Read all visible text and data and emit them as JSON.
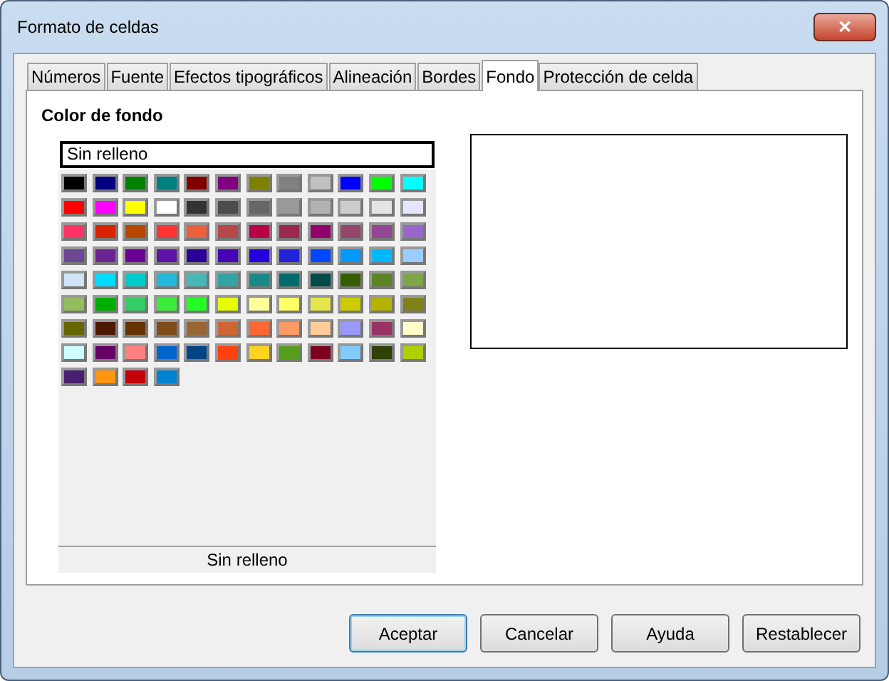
{
  "window": {
    "title": "Formato de celdas",
    "close": "✕"
  },
  "tabs": [
    {
      "label": "Números",
      "selected": false
    },
    {
      "label": "Fuente",
      "selected": false
    },
    {
      "label": "Efectos tipográficos",
      "selected": false
    },
    {
      "label": "Alineación",
      "selected": false
    },
    {
      "label": "Bordes",
      "selected": false
    },
    {
      "label": "Fondo",
      "selected": true
    },
    {
      "label": "Protección de celda",
      "selected": false
    }
  ],
  "section_title": "Color de fondo",
  "color_list": {
    "selected_name": "Sin relleno",
    "footer": "Sin relleno",
    "swatches": [
      {
        "color": "#000000"
      },
      {
        "color": "#000080"
      },
      {
        "color": "#008000"
      },
      {
        "color": "#008080"
      },
      {
        "color": "#800000"
      },
      {
        "color": "#800080"
      },
      {
        "color": "#808000"
      },
      {
        "color": "#808080"
      },
      {
        "color": "#c0c0c0"
      },
      {
        "color": "#0000ff"
      },
      {
        "color": "#00ff00"
      },
      {
        "color": "#00ffff"
      },
      {
        "color": "#ff0000"
      },
      {
        "color": "#ff00ff"
      },
      {
        "color": "#ffff00"
      },
      {
        "color": "#ffffff"
      },
      {
        "color": "#333333"
      },
      {
        "color": "#4c4c4c"
      },
      {
        "color": "#666666"
      },
      {
        "color": "#999999"
      },
      {
        "color": "#b2b2b2"
      },
      {
        "color": "#cccccc"
      },
      {
        "color": "#e5e5e5"
      },
      {
        "color": "#e6e6ff"
      },
      {
        "color": "#ff3366"
      },
      {
        "color": "#dc2300"
      },
      {
        "color": "#b84700"
      },
      {
        "color": "#ff3333"
      },
      {
        "color": "#eb613d"
      },
      {
        "color": "#b84747"
      },
      {
        "color": "#b80047"
      },
      {
        "color": "#99284c"
      },
      {
        "color": "#94006b"
      },
      {
        "color": "#94476b"
      },
      {
        "color": "#944794"
      },
      {
        "color": "#9966cc"
      },
      {
        "color": "#6b4794"
      },
      {
        "color": "#6b2394"
      },
      {
        "color": "#6b0094"
      },
      {
        "color": "#5e11a6"
      },
      {
        "color": "#280099"
      },
      {
        "color": "#4700b8"
      },
      {
        "color": "#2300dc"
      },
      {
        "color": "#2323dc"
      },
      {
        "color": "#0047ff"
      },
      {
        "color": "#0099ff"
      },
      {
        "color": "#00b8ff"
      },
      {
        "color": "#99ccff"
      },
      {
        "color": "#d0e4f8"
      },
      {
        "color": "#00dcff"
      },
      {
        "color": "#00cccc"
      },
      {
        "color": "#23b8dc"
      },
      {
        "color": "#47b8b8"
      },
      {
        "color": "#33a3a3"
      },
      {
        "color": "#198a8a"
      },
      {
        "color": "#006b6b"
      },
      {
        "color": "#004a4a"
      },
      {
        "color": "#355e00"
      },
      {
        "color": "#5c8526"
      },
      {
        "color": "#7da647"
      },
      {
        "color": "#94bd5e"
      },
      {
        "color": "#00ae00"
      },
      {
        "color": "#33cc66"
      },
      {
        "color": "#3deb3d"
      },
      {
        "color": "#23ff23"
      },
      {
        "color": "#e6ff00"
      },
      {
        "color": "#ffff99"
      },
      {
        "color": "#ffff66"
      },
      {
        "color": "#e6e64c"
      },
      {
        "color": "#cccc00"
      },
      {
        "color": "#b3b300"
      },
      {
        "color": "#808019"
      },
      {
        "color": "#666600"
      },
      {
        "color": "#4c1900"
      },
      {
        "color": "#663300"
      },
      {
        "color": "#804c19"
      },
      {
        "color": "#996633"
      },
      {
        "color": "#cc6633"
      },
      {
        "color": "#ff6633"
      },
      {
        "color": "#ff9966"
      },
      {
        "color": "#ffcc99"
      },
      {
        "color": "#9999ff"
      },
      {
        "color": "#993366"
      },
      {
        "color": "#ffffcc"
      },
      {
        "color": "#ccffff"
      },
      {
        "color": "#660066"
      },
      {
        "color": "#ff8080"
      },
      {
        "color": "#0066cc"
      },
      {
        "color": "#004586"
      },
      {
        "color": "#ff420e"
      },
      {
        "color": "#ffd320"
      },
      {
        "color": "#579d1c"
      },
      {
        "color": "#7e0021"
      },
      {
        "color": "#83caff"
      },
      {
        "color": "#314004"
      },
      {
        "color": "#aecf00"
      },
      {
        "color": "#4b1f6f"
      },
      {
        "color": "#ff950e"
      },
      {
        "color": "#c5000b"
      },
      {
        "color": "#0084d1"
      }
    ]
  },
  "buttons": [
    "Aceptar",
    "Cancelar",
    "Ayuda",
    "Restablecer"
  ]
}
